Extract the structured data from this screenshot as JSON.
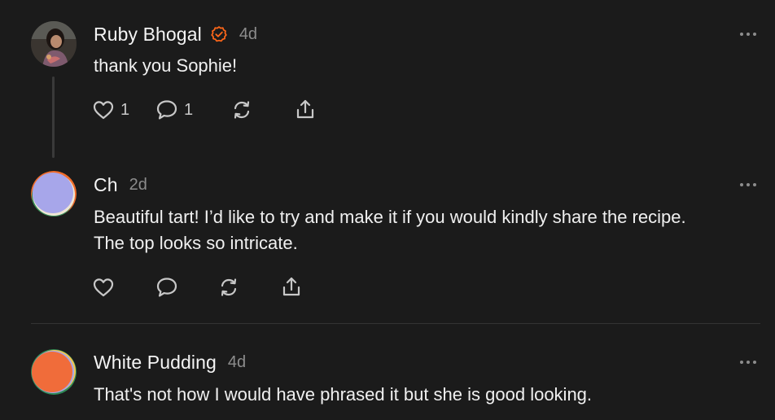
{
  "comments": [
    {
      "author": "Ruby Bhogal",
      "verified": true,
      "time": "4d",
      "text": "thank you Sophie!",
      "likes": "1",
      "replies": "1"
    },
    {
      "author": "Ch",
      "verified": false,
      "time": "2d",
      "text_line1": "Beautiful tart! I’d like to try and make it if you would kindly share the recipe.",
      "text_line2": "The top looks so intricate."
    },
    {
      "author": "White Pudding",
      "verified": false,
      "time": "4d",
      "text": "That's not how I would have phrased it but she is good looking."
    }
  ],
  "colors": {
    "background": "#1b1b1b",
    "verified_badge": "#ff6719",
    "icon": "#c8c8c8",
    "muted_text": "#8d8d8d"
  },
  "icons": {
    "like": "heart-icon",
    "reply": "comment-bubble-icon",
    "restack": "restack-icon",
    "share": "share-icon",
    "more": "more-dots-icon",
    "verified": "verified-check-icon"
  }
}
